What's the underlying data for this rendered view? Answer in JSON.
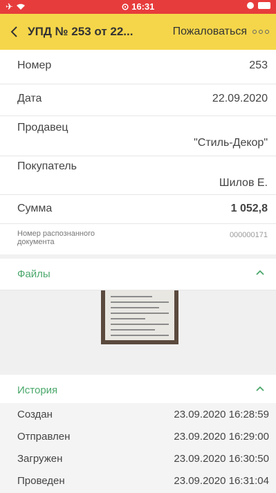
{
  "status_bar": {
    "time": "16:31"
  },
  "header": {
    "back_icon": "chevron-left-icon",
    "title": "УПД № 253 от 22...",
    "complain_label": "Пожаловаться",
    "more_icon": "more-icon"
  },
  "fields": {
    "number": {
      "label": "Номер",
      "value": "253"
    },
    "date": {
      "label": "Дата",
      "value": "22.09.2020"
    },
    "seller": {
      "label": "Продавец",
      "value": "\"Стиль-Декор\""
    },
    "buyer": {
      "label": "Покупатель",
      "value": "Шилов Е."
    },
    "sum": {
      "label": "Сумма",
      "value": "1 052,8"
    },
    "recognized_doc": {
      "label": "Номер распознанного документа",
      "value": "000000171"
    }
  },
  "files_section": {
    "title": "Файлы"
  },
  "history_section": {
    "title": "История",
    "items": [
      {
        "event": "Создан",
        "datetime": "23.09.2020 16:28:59"
      },
      {
        "event": "Отправлен",
        "datetime": "23.09.2020 16:29:00"
      },
      {
        "event": "Загружен",
        "datetime": "23.09.2020 16:30:50"
      },
      {
        "event": "Проведен",
        "datetime": "23.09.2020 16:31:04"
      }
    ]
  },
  "colors": {
    "status_bar": "#e73c3c",
    "header": "#f5d64a",
    "accent_green": "#4aa86b"
  }
}
